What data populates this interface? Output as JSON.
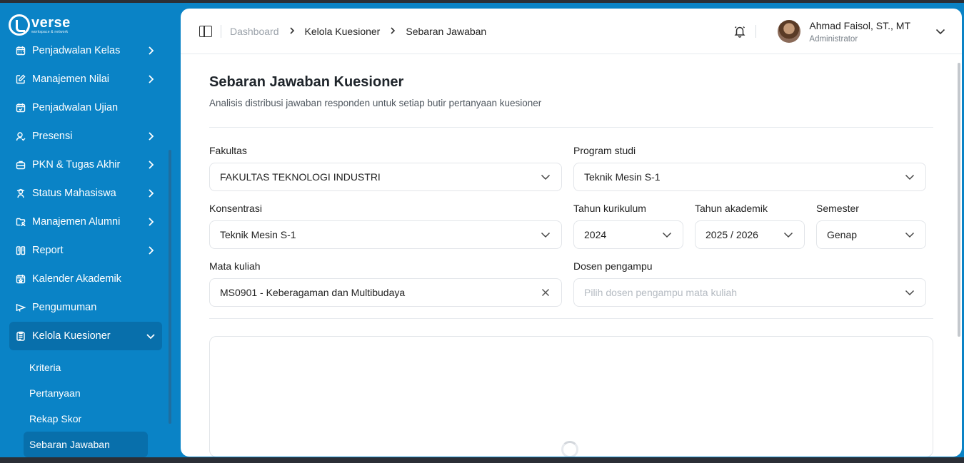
{
  "sidebar": {
    "logo_text": "verse",
    "logo_tagline": "workspace & network",
    "items": [
      {
        "label": "Penjadwalan Kelas",
        "icon": "calendar-grid-icon",
        "has_children": true
      },
      {
        "label": "Manajemen Nilai",
        "icon": "edit-note-icon",
        "has_children": true
      },
      {
        "label": "Penjadwalan Ujian",
        "icon": "calendar-check-icon",
        "has_children": false
      },
      {
        "label": "Presensi",
        "icon": "user-check-icon",
        "has_children": true
      },
      {
        "label": "PKN & Tugas Akhir",
        "icon": "briefcase-icon",
        "has_children": true
      },
      {
        "label": "Status Mahasiswa",
        "icon": "student-status-icon",
        "has_children": true
      },
      {
        "label": "Manajemen Alumni",
        "icon": "folder-user-icon",
        "has_children": true
      },
      {
        "label": "Report",
        "icon": "report-icon",
        "has_children": true
      },
      {
        "label": "Kalender Akademik",
        "icon": "calendar-star-icon",
        "has_children": false
      },
      {
        "label": "Pengumuman",
        "icon": "megaphone-icon",
        "has_children": false
      },
      {
        "label": "Kelola Kuesioner",
        "icon": "clipboard-icon",
        "has_children": true,
        "expanded": true
      }
    ],
    "sub_items": [
      {
        "label": "Kriteria"
      },
      {
        "label": "Pertanyaan"
      },
      {
        "label": "Rekap Skor"
      },
      {
        "label": "Sebaran Jawaban",
        "active": true
      }
    ]
  },
  "header": {
    "breadcrumb": [
      "Dashboard",
      "Kelola Kuesioner",
      "Sebaran Jawaban"
    ],
    "user_name": "Ahmad Faisol, ST., MT",
    "user_role": "Administrator"
  },
  "page": {
    "title": "Sebaran Jawaban Kuesioner",
    "subtitle": "Analisis distribusi jawaban responden untuk setiap butir pertanyaan kuesioner"
  },
  "filters": {
    "fakultas": {
      "label": "Fakultas",
      "value": "FAKULTAS TEKNOLOGI INDUSTRI"
    },
    "program_studi": {
      "label": "Program studi",
      "value": "Teknik Mesin S-1"
    },
    "konsentrasi": {
      "label": "Konsentrasi",
      "value": "Teknik Mesin S-1"
    },
    "tahun_kurikulum": {
      "label": "Tahun kurikulum",
      "value": "2024"
    },
    "tahun_akademik": {
      "label": "Tahun akademik",
      "value": "2025 / 2026"
    },
    "semester": {
      "label": "Semester",
      "value": "Genap"
    },
    "mata_kuliah": {
      "label": "Mata kuliah",
      "value": "MS0901 - Keberagaman dan Multibudaya"
    },
    "dosen_pengampu": {
      "label": "Dosen pengampu",
      "placeholder": "Pilih dosen pengampu mata kuliah"
    }
  },
  "colors": {
    "sidebar_bg": "#0a83c6",
    "sidebar_active": "#086fab",
    "text_dark": "#1e242a"
  }
}
